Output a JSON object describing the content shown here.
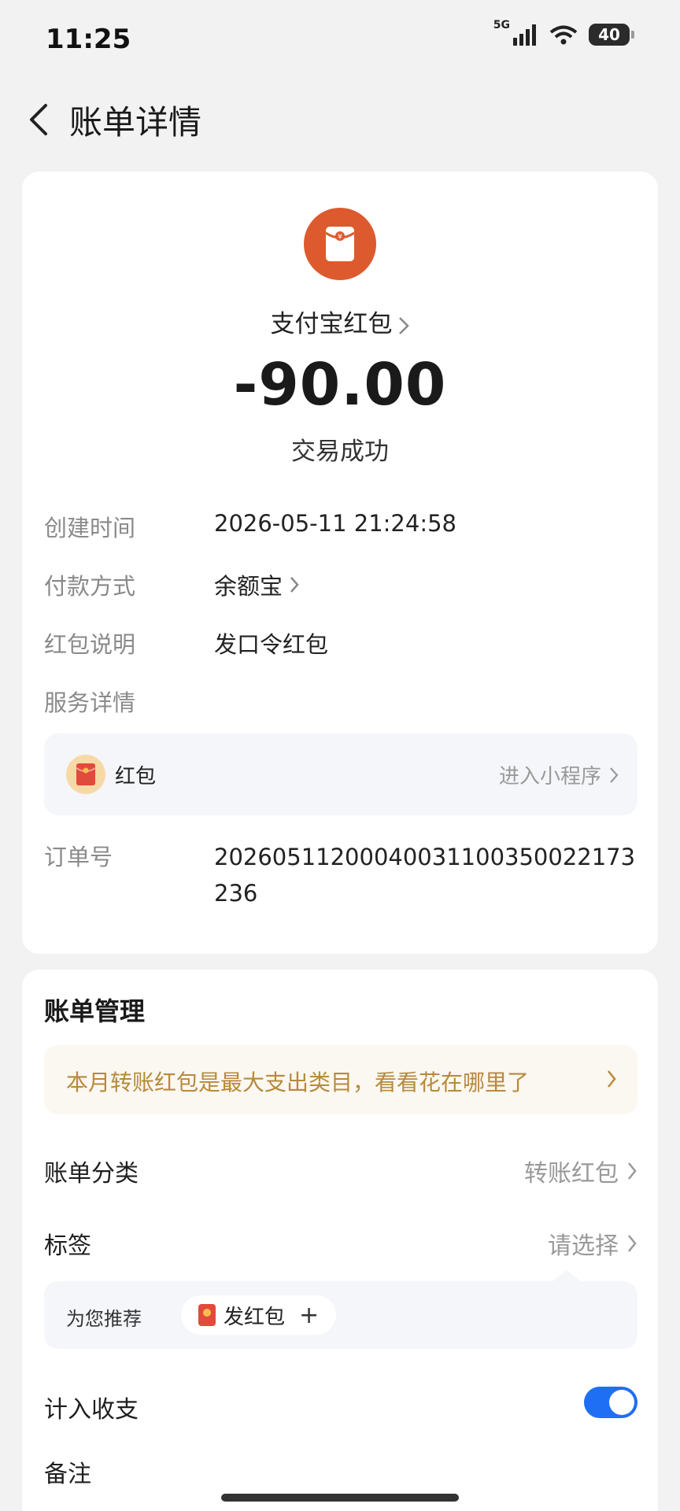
{
  "status_bar": {
    "time": "11:25",
    "network": "5G",
    "battery": "40"
  },
  "header": {
    "back_icon": "chevron-left-icon",
    "title": "账单详情"
  },
  "transaction": {
    "icon": "red-envelope-icon",
    "icon_color": "#dc5a2d",
    "payee": "支付宝红包",
    "amount": "-90.00",
    "status": "交易成功"
  },
  "details": {
    "created_label": "创建时间",
    "created_value": "2026-05-11 21:24:58",
    "payment_label": "付款方式",
    "payment_value": "余额宝",
    "note_label": "红包说明",
    "note_value": "发口令红包",
    "service_label": "服务详情",
    "order_label": "订单号",
    "order_value": "20260511200040031100350022173236"
  },
  "service": {
    "name": "红包",
    "link": "进入小程序"
  },
  "management": {
    "title": "账单管理",
    "promo_text": "本月转账红包是最大支出类目，看看花在哪里了",
    "promo_color": "#b78a3c",
    "category_label": "账单分类",
    "category_value": "转账红包",
    "tag_label": "标签",
    "tag_value": "请选择",
    "recommend_label": "为您推荐",
    "recommend_chip": "发红包",
    "recommend_add": "+",
    "count_label": "计入收支",
    "count_enabled": true,
    "toggle_color": "#1f6ff5",
    "remark_label": "备注"
  }
}
